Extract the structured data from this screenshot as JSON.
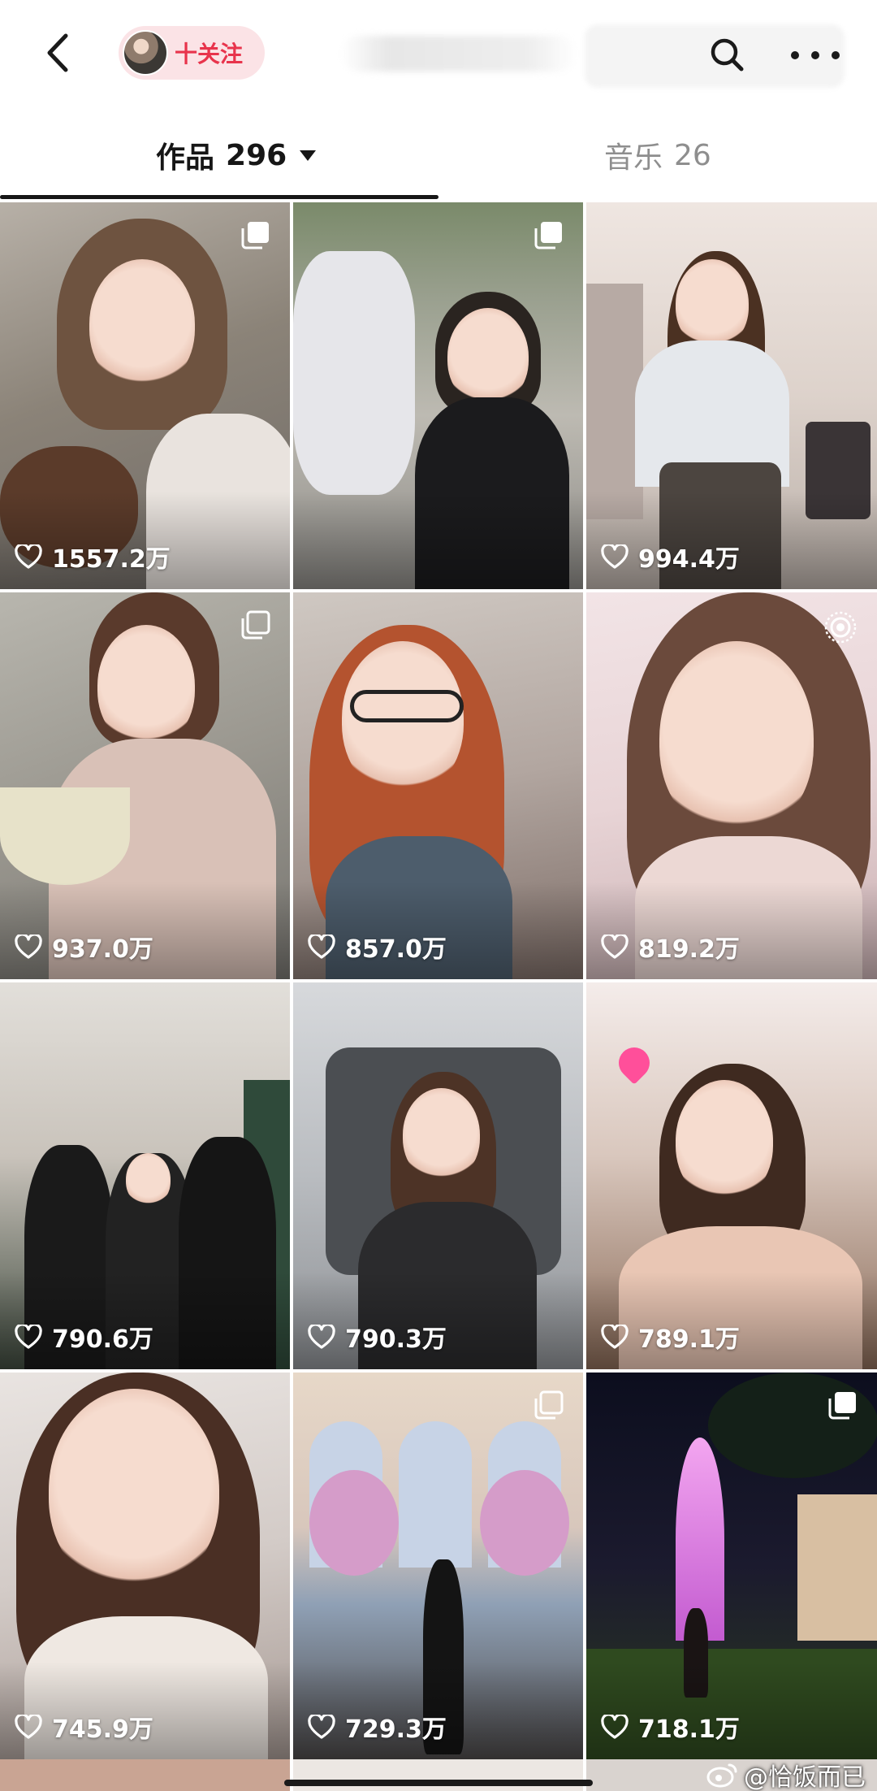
{
  "header": {
    "follow_label": "十关注",
    "icons": {
      "back": "chevron-left-icon",
      "search": "search-icon",
      "more": "more-dots-icon"
    }
  },
  "tabs": [
    {
      "label": "作品",
      "count": "296",
      "active": true
    },
    {
      "label": "音乐",
      "count": "26",
      "active": false
    }
  ],
  "videos": [
    {
      "likes": "1557.2万",
      "badge": "multi-image"
    },
    {
      "likes": "",
      "badge": "multi-image"
    },
    {
      "likes": "994.4万",
      "badge": ""
    },
    {
      "likes": "937.0万",
      "badge": "multi-image"
    },
    {
      "likes": "857.0万",
      "badge": ""
    },
    {
      "likes": "819.2万",
      "badge": "live-photo"
    },
    {
      "likes": "790.6万",
      "badge": ""
    },
    {
      "likes": "790.3万",
      "badge": ""
    },
    {
      "likes": "789.1万",
      "badge": ""
    },
    {
      "likes": "745.9万",
      "badge": ""
    },
    {
      "likes": "729.3万",
      "badge": "multi-image"
    },
    {
      "likes": "718.1万",
      "badge": "multi-image"
    }
  ],
  "watermark": {
    "text": "@恰饭而已",
    "icon": "weibo-icon"
  },
  "colors": {
    "accent": "#e8344c",
    "follow_bg": "#fbe3e6",
    "active_tab": "#161616",
    "inactive_tab": "#8e8e8e"
  }
}
